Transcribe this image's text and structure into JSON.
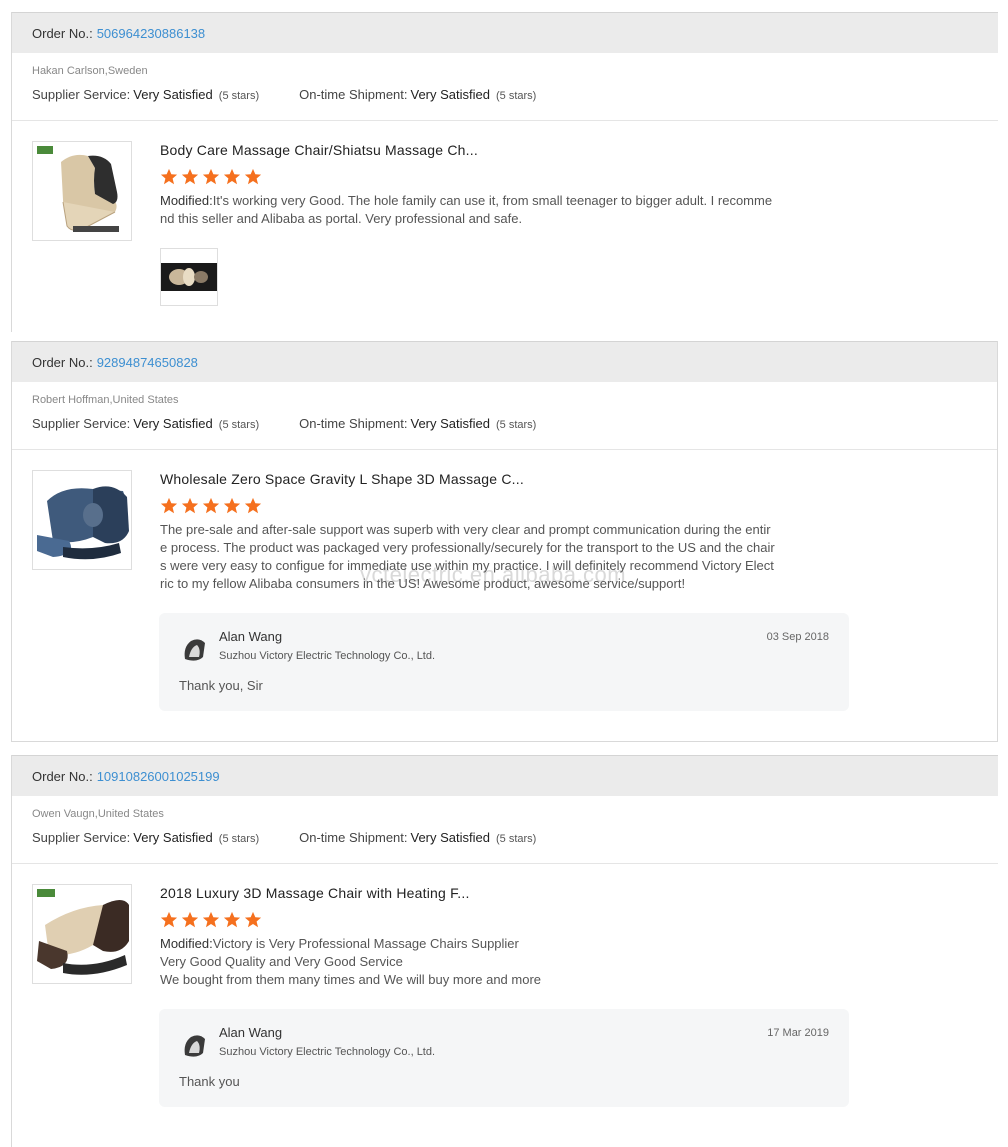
{
  "labels": {
    "order_no": "Order No.:",
    "supplier_service": "Supplier Service:",
    "ontime_shipment": "On-time Shipment:",
    "modified": "Modified:"
  },
  "reviews": [
    {
      "order_number": "506964230886138",
      "buyer": "Hakan Carlson,Sweden",
      "supplier_service": "Very Satisfied",
      "supplier_stars": "(5 stars)",
      "shipment": "Very Satisfied",
      "shipment_stars": "(5 stars)",
      "product_title": "Body Care Massage Chair/Shiatsu Massage Ch...",
      "rating": 5,
      "text_lines": [
        "It's working very Good. The hole family can use it, from small teenager to bigger adult. I recomme",
        "nd this seller and Alibaba as portal. Very professional and safe."
      ],
      "thumb_icon": "massage-chair-beige-icon",
      "attachment_icon": "review-photo-icon"
    },
    {
      "order_number": "92894874650828",
      "buyer": "Robert Hoffman,United States",
      "supplier_service": "Very Satisfied",
      "supplier_stars": "(5 stars)",
      "shipment": "Very Satisfied",
      "shipment_stars": "(5 stars)",
      "product_title": "Wholesale Zero Space Gravity L Shape 3D Massage C...",
      "rating": 5,
      "text_lines": [
        "The pre-sale and after-sale support was superb with very clear and prompt communication during the entir",
        "e process. The product was packaged very professionally/securely for the transport to the US and the chair",
        "s were very easy to configue for immediate use within my practice. I will definitely recommend Victory Elect",
        "ric to my fellow Alibaba consumers in the US! Awesome product, awesome service/support!"
      ],
      "thumb_icon": "massage-chair-blue-icon",
      "reply": {
        "name": "Alan Wang",
        "company": "Suzhou Victory Electric Technology Co., Ltd.",
        "date": "03 Sep 2018",
        "message": "Thank you, Sir"
      }
    },
    {
      "order_number": "10910826001025199",
      "buyer": "Owen Vaugn,United States",
      "supplier_service": "Very Satisfied",
      "supplier_stars": "(5 stars)",
      "shipment": "Very Satisfied",
      "shipment_stars": "(5 stars)",
      "product_title": "2018 Luxury 3D Massage Chair with Heating F...",
      "rating": 5,
      "text_lines": [
        "Victory is Very Professional Massage Chairs Supplier",
        "Very Good Quality and Very Good Service",
        "We bought from them many times and We will buy more and more"
      ],
      "thumb_icon": "massage-chair-brown-icon",
      "reply": {
        "name": "Alan Wang",
        "company": "Suzhou Victory Electric Technology Co., Ltd.",
        "date": "17 Mar 2019",
        "message": "Thank you"
      }
    }
  ],
  "watermark": "vctelectric.en.alibaba.com",
  "colors": {
    "star": "#f5701e",
    "link": "#3d8fd1",
    "bar": "#ebebeb",
    "reply_bg": "#f5f6f7"
  }
}
